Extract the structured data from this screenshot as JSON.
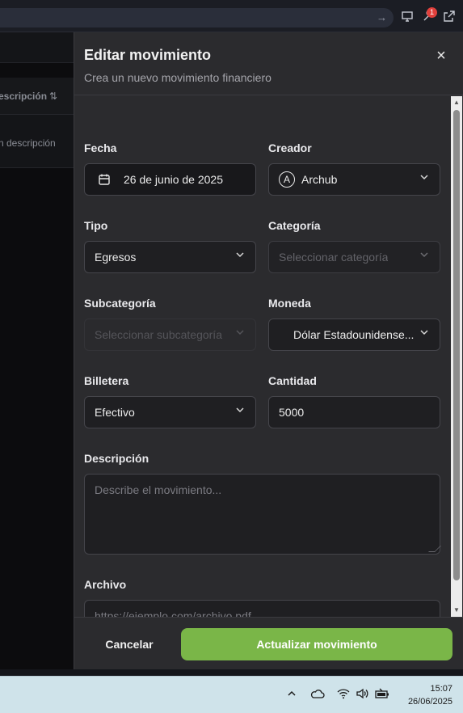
{
  "browser": {
    "url_arrow": "→",
    "notification_count": "1"
  },
  "background": {
    "column_header": "escripción",
    "sort_glyph": "⇅",
    "row_text": "n descripción"
  },
  "modal": {
    "title": "Editar movimiento",
    "subtitle": "Crea un nuevo movimiento financiero",
    "close_label": "×",
    "fields": {
      "fecha": {
        "label": "Fecha",
        "value": "26 de junio de 2025"
      },
      "creador": {
        "label": "Creador",
        "value": "Archub",
        "avatar_initial": "A"
      },
      "tipo": {
        "label": "Tipo",
        "value": "Egresos"
      },
      "categoria": {
        "label": "Categoría",
        "placeholder": "Seleccionar categoría"
      },
      "subcategoria": {
        "label": "Subcategoría",
        "placeholder": "Seleccionar subcategoría"
      },
      "moneda": {
        "label": "Moneda",
        "value": "Dólar Estadounidense..."
      },
      "billetera": {
        "label": "Billetera",
        "value": "Efectivo"
      },
      "cantidad": {
        "label": "Cantidad",
        "value": "5000"
      },
      "descripcion": {
        "label": "Descripción",
        "placeholder": "Describe el movimiento..."
      },
      "archivo": {
        "label": "Archivo",
        "placeholder": "https://ejemplo.com/archivo.pdf"
      }
    },
    "footer": {
      "cancel_label": "Cancelar",
      "submit_label": "Actualizar movimiento"
    }
  },
  "taskbar": {
    "time": "15:07",
    "date": "26/06/2025"
  },
  "colors": {
    "primary": "#7ab648",
    "modal_bg": "#2b2b2e",
    "input_bg": "#1f1f22"
  }
}
